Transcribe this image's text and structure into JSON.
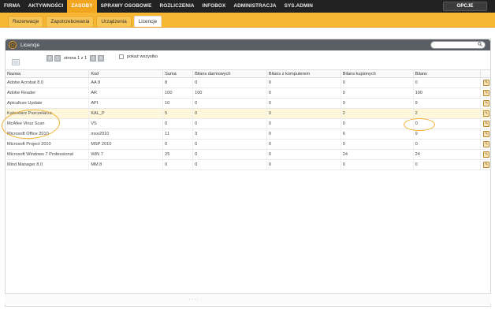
{
  "topnav": {
    "items": [
      "FIRMA",
      "AKTYWNOŚCI",
      "ZASOBY",
      "SPRAWY OSOBOWE",
      "ROZLICZENIA",
      "INFOBOX",
      "ADMINISTRACJA",
      "SYS.ADMIN"
    ],
    "active_index": 2,
    "options_label": "OPCJE"
  },
  "subnav": {
    "tabs": [
      "Rezerwacje",
      "Zapotrzebowania",
      "Urządzenia",
      "Licencje"
    ],
    "active_index": 3
  },
  "panel": {
    "title": "Licencje",
    "icon": "licence-icon",
    "search_icon": "search-icon"
  },
  "pager": {
    "text": "strona 1 z 1",
    "show_all_label": "pokaż wszystko"
  },
  "table": {
    "columns": [
      "Nazwa",
      "Kod",
      "Suma",
      "Bilans darmowych",
      "Bilans z komputerem",
      "Bilans kupionych",
      "Bilans"
    ],
    "rows": [
      [
        "Adobe Acrobat 8.0",
        "AA 8",
        "8",
        "0",
        "0",
        "0",
        "0"
      ],
      [
        "Adobe Reader",
        "AR",
        "100",
        "100",
        "0",
        "0",
        "100"
      ],
      [
        "Apiculture Update",
        "API",
        "10",
        "0",
        "0",
        "9",
        "9"
      ],
      [
        "Kalendarz Pszczelarza",
        "KAL_P",
        "5",
        "0",
        "0",
        "2",
        "2"
      ],
      [
        "McAfee Virus Scan",
        "VS",
        "0",
        "0",
        "0",
        "0",
        "0"
      ],
      [
        "Microsoft Office 2010",
        "mso2010",
        "11",
        "3",
        "0",
        "6",
        "9"
      ],
      [
        "Microsoft Project 2010",
        "MSP 2010",
        "0",
        "0",
        "0",
        "0",
        "0"
      ],
      [
        "Microsoft Windows 7 Professional",
        "WIN 7",
        "25",
        "0",
        "0",
        "24",
        "24"
      ],
      [
        "Mind Manager 8.0",
        "MM 8",
        "0",
        "0",
        "0",
        "0",
        "0"
      ]
    ],
    "highlighted_row": 3,
    "row_action_icon": "edit-icon"
  },
  "colors": {
    "accent": "#f7b733",
    "active_tab": "#f2a51f",
    "topbar": "#222222",
    "panel_header": "#5a5f66",
    "highlight_row": "#fff7dc"
  }
}
